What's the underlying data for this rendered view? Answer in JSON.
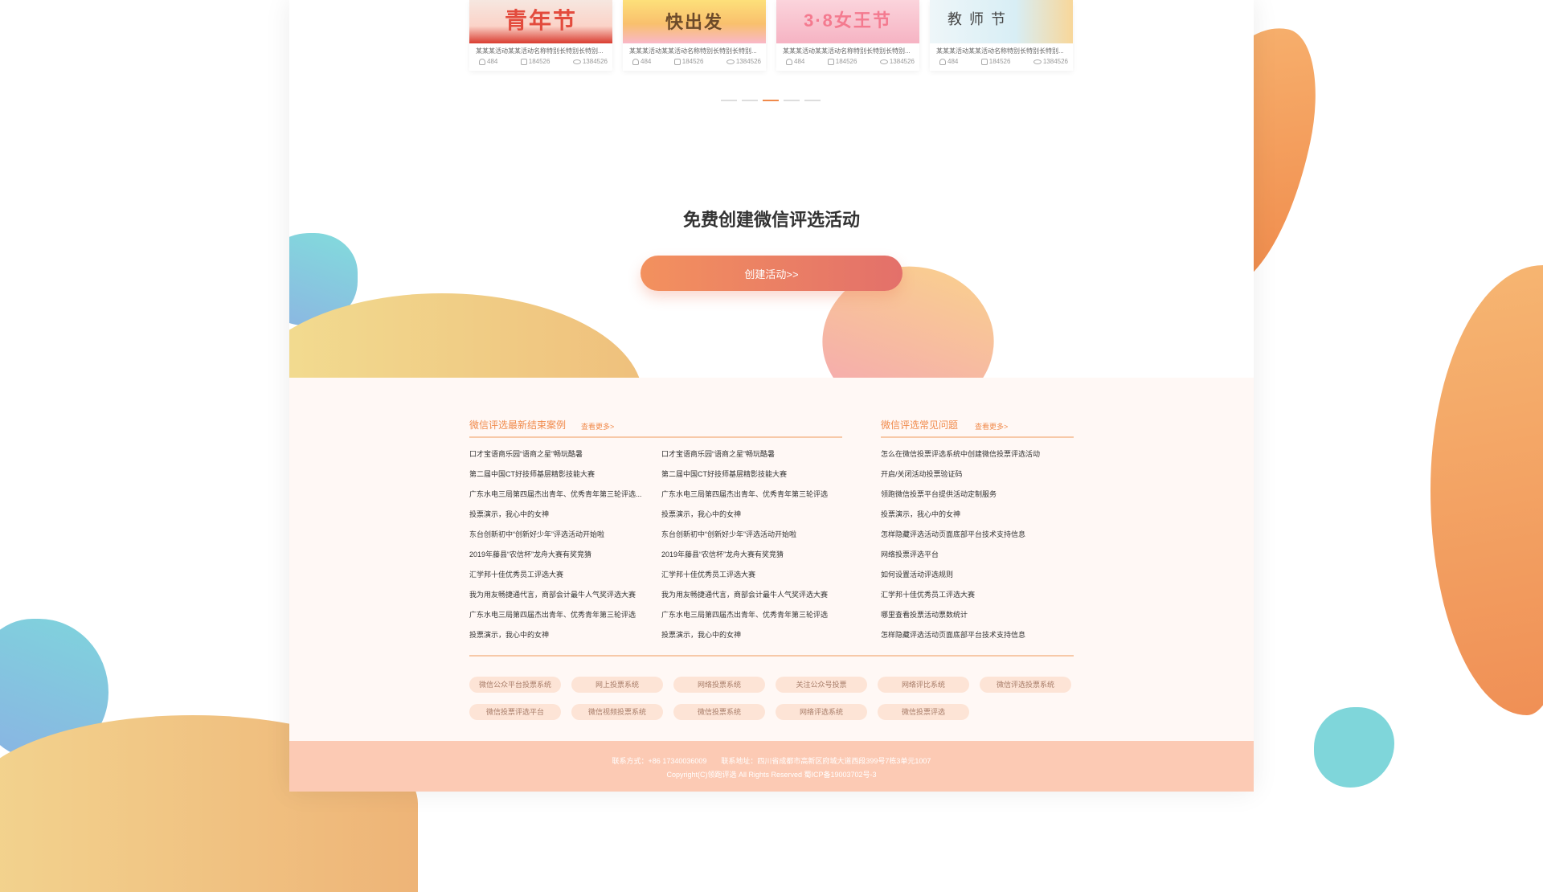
{
  "cards": [
    {
      "thumb_text": "青年节",
      "name": "某某某活动某某活动名称特别长特别长特别...",
      "participants": "484",
      "votes": "184526",
      "views": "1384526"
    },
    {
      "thumb_text": "快出发",
      "name": "某某某活动某某活动名称特别长特别长特别...",
      "participants": "484",
      "votes": "184526",
      "views": "1384526"
    },
    {
      "thumb_text": "3·8女王节",
      "name": "某某某活动某某活动名称特别长特别长特别...",
      "participants": "484",
      "votes": "184526",
      "views": "1384526"
    },
    {
      "thumb_text": "教 师 节",
      "name": "某某某活动某某活动名称特别长特别长特别...",
      "participants": "484",
      "votes": "184526",
      "views": "1384526"
    }
  ],
  "carousel": {
    "pages": 5,
    "active_index": 2
  },
  "cta": {
    "headline": "免费创建微信评选活动",
    "button": "创建活动>>"
  },
  "cases": {
    "title": "微信评选最新结束案例",
    "more": "查看更多>",
    "col1": [
      "口才宝语商乐园“语商之星”畅玩酷暑",
      "第二届中国CT好技师基层精影技能大赛",
      "广东水电三局第四届杰出青年、优秀青年第三轮评选...",
      "投票演示，我心中的女神",
      "东台创新初中“创新好少年”评选活动开始啦",
      "2019年藤县“农信杯”龙舟大赛有奖竞猜",
      "汇学邦十佳优秀员工评选大赛",
      "我为用友畅捷通代言，商部会计最牛人气奖评选大赛",
      "广东水电三局第四届杰出青年、优秀青年第三轮评选",
      "投票演示，我心中的女神"
    ],
    "col2": [
      "口才宝语商乐园“语商之星”畅玩酷暑",
      "第二届中国CT好技师基层精影技能大赛",
      "广东水电三局第四届杰出青年、优秀青年第三轮评选",
      "投票演示，我心中的女神",
      "东台创新初中“创新好少年”评选活动开始啦",
      "2019年藤县“农信杯”龙舟大赛有奖竞猜",
      "汇学邦十佳优秀员工评选大赛",
      "我为用友畅捷通代言，商部会计最牛人气奖评选大赛",
      "广东水电三局第四届杰出青年、优秀青年第三轮评选",
      "投票演示，我心中的女神"
    ]
  },
  "faq": {
    "title": "微信评选常见问题",
    "more": "查看更多>",
    "items": [
      "怎么在微信投票评选系统中创建微信投票评选活动",
      "开启/关闭活动投票验证码",
      "领跑微信投票平台提供活动定制服务",
      "投票演示，我心中的女神",
      "怎样隐藏评选活动页面底部平台技术支持信息",
      "网络投票评选平台",
      "如何设置活动评选规则",
      "汇学邦十佳优秀员工评选大赛",
      "哪里查看投票活动票数统计",
      "怎样隐藏评选活动页面底部平台技术支持信息"
    ]
  },
  "tags": [
    "微信公众平台投票系统",
    "网上投票系统",
    "网络投票系统",
    "关注公众号投票",
    "网络评比系统",
    "微信评选投票系统",
    "微信投票评选平台",
    "微信视频投票系统",
    "微信投票系统",
    "网络评选系统",
    "微信投票评选"
  ],
  "footer": {
    "line1": "联系方式：+86 17340036009　　联系地址：四川省成都市高新区府城大道西段399号7栋3单元1007",
    "line2": "Copyright(C)领跑评选 All Rights Reserved 蜀ICP备19003702号-3"
  },
  "colors": {
    "accent": "#f08a4b",
    "footer_bg": "#fccab4",
    "section_bg": "#fff8f5",
    "tag_bg": "#fde4d6"
  }
}
